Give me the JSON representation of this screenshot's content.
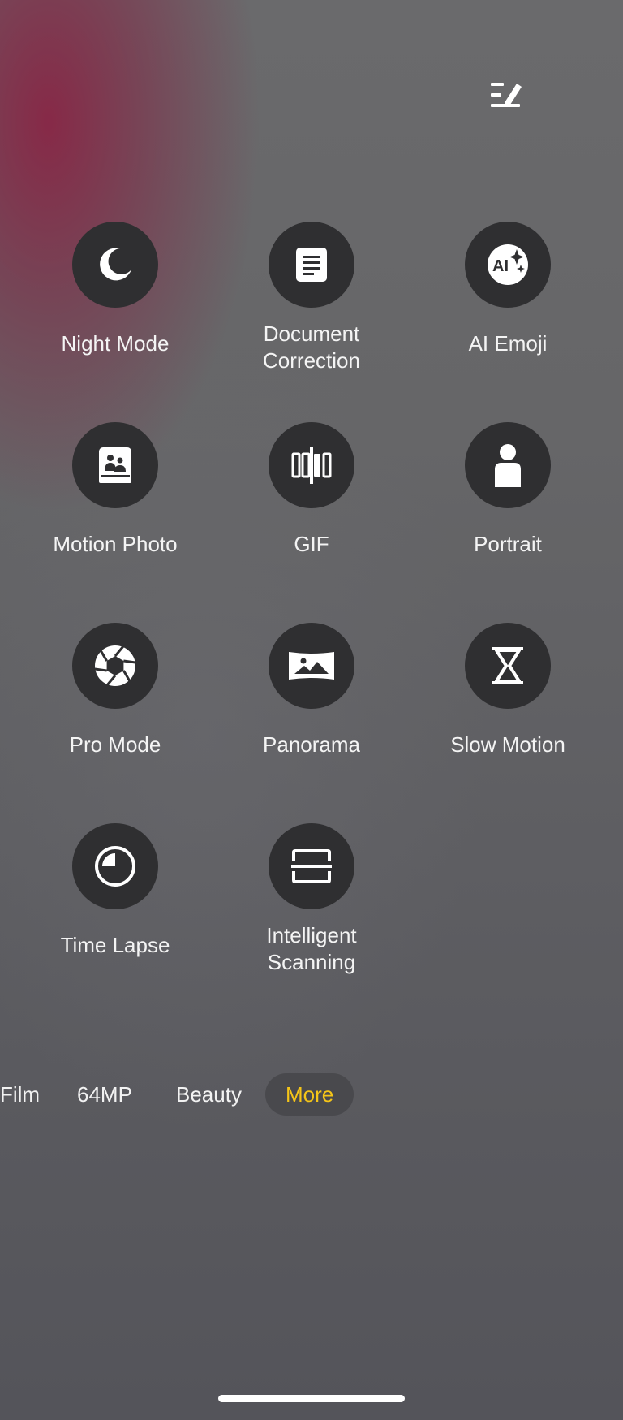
{
  "header": {
    "edit_icon": "edit-list-icon"
  },
  "modes": [
    {
      "label": "Night Mode",
      "icon": "moon-icon"
    },
    {
      "label": "Document\nCorrection",
      "icon": "document-icon"
    },
    {
      "label": "AI Emoji",
      "icon": "ai-emoji-icon"
    },
    {
      "label": "Motion Photo",
      "icon": "motion-photo-icon"
    },
    {
      "label": "GIF",
      "icon": "gif-icon"
    },
    {
      "label": "Portrait",
      "icon": "person-icon"
    },
    {
      "label": "Pro Mode",
      "icon": "aperture-icon"
    },
    {
      "label": "Panorama",
      "icon": "landscape-icon"
    },
    {
      "label": "Slow Motion",
      "icon": "hourglass-icon"
    },
    {
      "label": "Time Lapse",
      "icon": "timer-icon"
    },
    {
      "label": "Intelligent\nScanning",
      "icon": "scan-icon"
    }
  ],
  "mode_bar": {
    "tabs": [
      "Film",
      "64MP",
      "Beauty",
      "More"
    ],
    "active": "More",
    "active_color": "#f5c518"
  }
}
